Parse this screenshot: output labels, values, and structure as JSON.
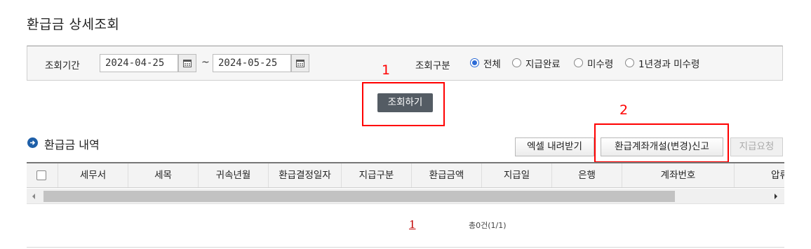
{
  "page": {
    "title": "환급금 상세조회"
  },
  "search": {
    "period_label": "조회기간",
    "start_date": "2024-04-25",
    "end_date": "2024-05-25",
    "tilde": "~",
    "type_label": "조회구분",
    "options": [
      {
        "label": "전체",
        "checked": true
      },
      {
        "label": "지급완료",
        "checked": false
      },
      {
        "label": "미수령",
        "checked": false
      },
      {
        "label": "1년경과 미수령",
        "checked": false
      }
    ],
    "submit_label": "조회하기"
  },
  "annotations": {
    "one": "1",
    "two": "2"
  },
  "section": {
    "title": "환급금 내역",
    "buttons": {
      "excel": "엑셀 내려받기",
      "account_report": "환급계좌개설(변경)신고",
      "payment_request": "지급요청"
    }
  },
  "table": {
    "columns": [
      "세무서",
      "세목",
      "귀속년월",
      "환급결정일자",
      "지급구분",
      "환급금액",
      "지급일",
      "은행",
      "계좌번호",
      "압류"
    ]
  },
  "pagination": {
    "current": "1",
    "total_text": "총0건(1/1)"
  },
  "colors": {
    "accent": "#2c6bd6",
    "annotation": "#ff0000",
    "search_button": "#545c64",
    "section_icon": "#1e5fa8"
  }
}
